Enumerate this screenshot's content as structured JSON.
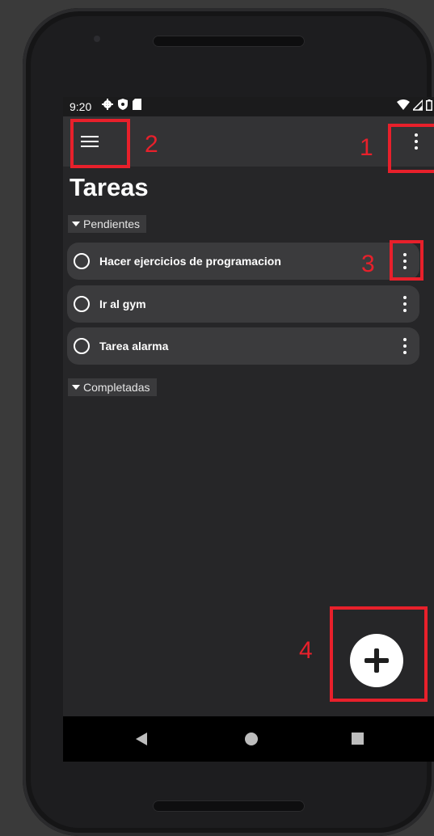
{
  "status_bar": {
    "time": "9:20",
    "left_icons": [
      "gear-icon",
      "shield-icon",
      "sd-card-icon"
    ],
    "right_icons": [
      "wifi-icon",
      "signal-icon",
      "battery-icon"
    ]
  },
  "toolbar": {
    "menu_icon": "hamburger-icon",
    "overflow_icon": "more-vert-icon"
  },
  "page_title": "Tareas",
  "sections": {
    "pending_label": "Pendientes",
    "completed_label": "Completadas"
  },
  "tasks": [
    {
      "label": "Hacer ejercicios de programacion"
    },
    {
      "label": "Ir al gym"
    },
    {
      "label": "Tarea alarma"
    }
  ],
  "fab": {
    "icon": "add-icon"
  },
  "annotations": {
    "one": "1",
    "two": "2",
    "three": "3",
    "four": "4",
    "color": "#e8202b"
  },
  "colors": {
    "background": "#262628",
    "toolbar": "#333335",
    "task_card": "#3b3b3d"
  }
}
